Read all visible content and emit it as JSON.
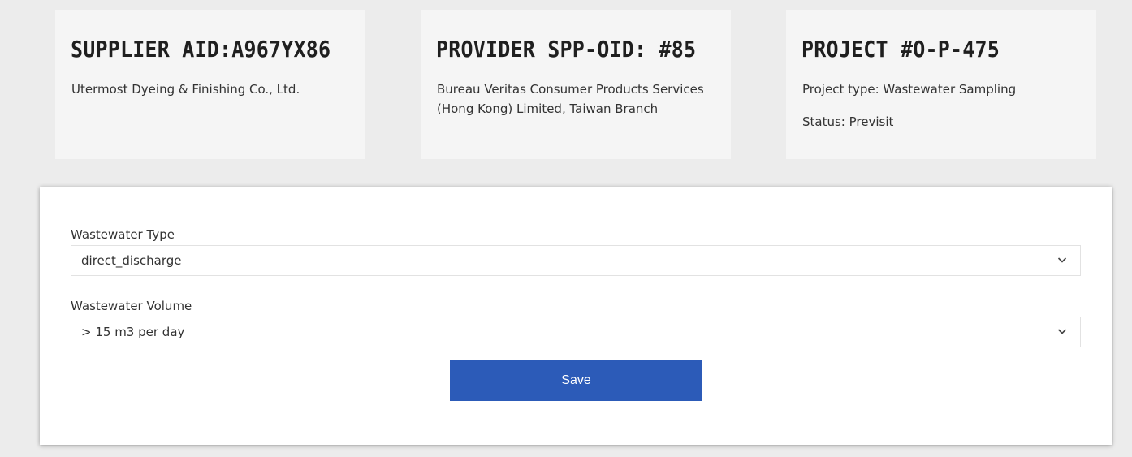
{
  "cards": [
    {
      "title": "SUPPLIER AID:A967YX86",
      "lines": [
        "Utermost Dyeing & Finishing Co., Ltd."
      ]
    },
    {
      "title": "PROVIDER SPP-OID: #85",
      "lines": [
        "Bureau Veritas Consumer Products Services (Hong Kong) Limited, Taiwan Branch"
      ]
    },
    {
      "title": "PROJECT #O-P-475",
      "lines": [
        "Project type: Wastewater Sampling",
        "Status: Previsit"
      ]
    }
  ],
  "form": {
    "wastewater_type": {
      "label": "Wastewater Type",
      "value": "direct_discharge"
    },
    "wastewater_volume": {
      "label": "Wastewater Volume",
      "value": "> 15 m3 per day"
    },
    "save_label": "Save"
  },
  "colors": {
    "accent": "#2c5bb8",
    "background": "#ececec",
    "card": "#f5f5f5"
  },
  "icons": {
    "select_arrow": "chevron-down-icon"
  }
}
